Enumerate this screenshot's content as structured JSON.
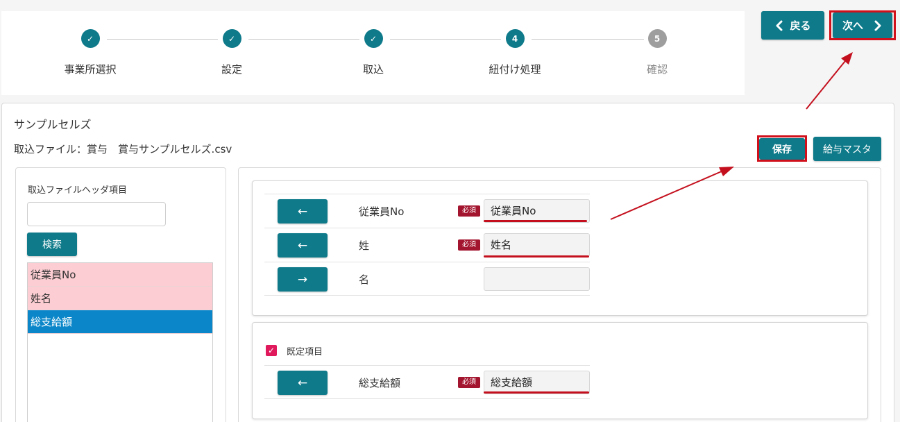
{
  "stepper": {
    "steps": [
      {
        "label": "事業所選択",
        "state": "done",
        "mark": "✓"
      },
      {
        "label": "設定",
        "state": "done",
        "mark": "✓"
      },
      {
        "label": "取込",
        "state": "done",
        "mark": "✓"
      },
      {
        "label": "紐付け処理",
        "state": "active",
        "mark": "4"
      },
      {
        "label": "確認",
        "state": "pending",
        "mark": "5"
      }
    ]
  },
  "nav": {
    "back_label": "戻る",
    "next_label": "次へ"
  },
  "card": {
    "title": "サンプルセルズ",
    "file_line": "取込ファイル：賞与　賞与サンプルセルズ.csv",
    "save_label": "保存",
    "master_label": "給与マスタ"
  },
  "left": {
    "title": "取込ファイルヘッダ項目",
    "search_value": "",
    "search_label": "検索",
    "items": [
      {
        "label": "従業員No",
        "state": "mapped"
      },
      {
        "label": "姓名",
        "state": "mapped"
      },
      {
        "label": "総支給額",
        "state": "selected"
      }
    ]
  },
  "mapping": {
    "required_badge": "必須",
    "group1": [
      {
        "arrow": "←",
        "field": "従業員No",
        "required": true,
        "value": "従業員No"
      },
      {
        "arrow": "←",
        "field": "姓",
        "required": true,
        "value": "姓名"
      },
      {
        "arrow": "→",
        "field": "名",
        "required": false,
        "value": ""
      }
    ],
    "group2": {
      "checkbox_label": "既定項目",
      "checked": true,
      "rows": [
        {
          "arrow": "←",
          "field": "総支給額",
          "required": true,
          "value": "総支給額"
        }
      ]
    }
  },
  "colors": {
    "teal": "#0e7a8a",
    "annotation_red": "#d0101b",
    "mapped_bg": "#fccdd2",
    "selected_bg": "#0b87c9",
    "required_badge": "#a3142e"
  }
}
